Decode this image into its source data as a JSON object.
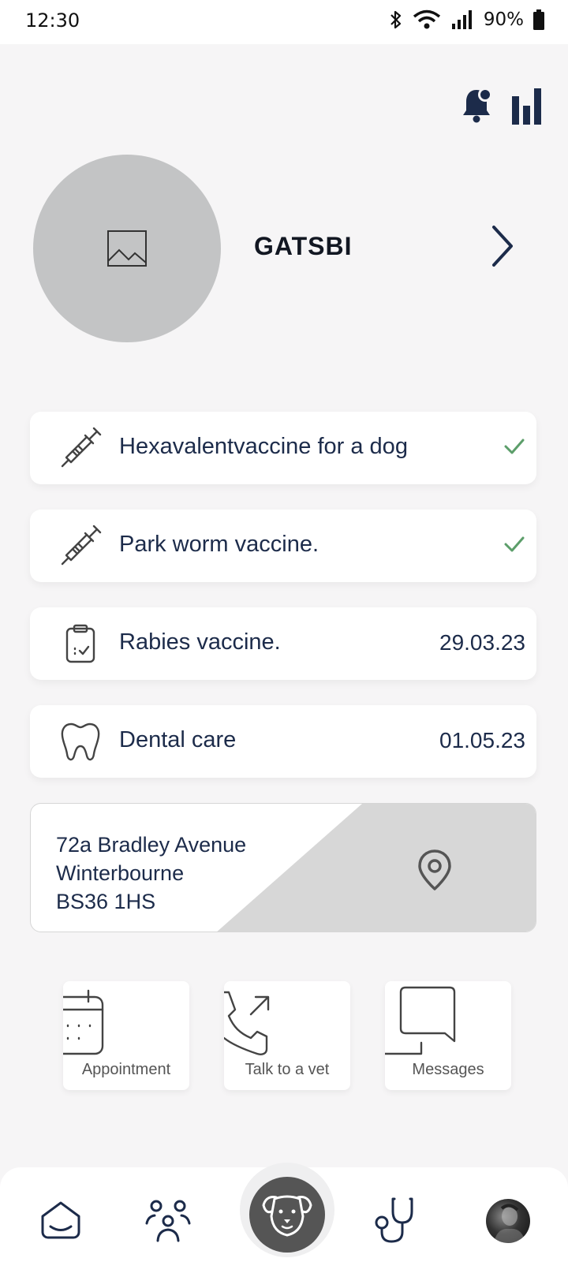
{
  "status_bar": {
    "time": "12:30",
    "battery": "90%",
    "icons": [
      "bluetooth-icon",
      "wifi-icon",
      "signal-icon",
      "battery-icon"
    ]
  },
  "header": {
    "icons": [
      "notification-bell-icon",
      "stats-bars-icon"
    ]
  },
  "profile": {
    "name": "GATSBI",
    "photo_icon": "image-placeholder-icon",
    "chevron_icon": "chevron-right-icon"
  },
  "health_items": [
    {
      "icon": "syringe-icon",
      "label": "Hexavalentvaccine for a dog",
      "status": "done",
      "date": ""
    },
    {
      "icon": "syringe-icon",
      "label": "Park worm vaccine.",
      "status": "done",
      "date": ""
    },
    {
      "icon": "clipboard-check-icon",
      "label": "Rabies vaccine.",
      "status": "scheduled",
      "date": "29.03.23"
    },
    {
      "icon": "tooth-icon",
      "label": "Dental care",
      "status": "scheduled",
      "date": "01.05.23"
    }
  ],
  "address": {
    "line1": "72a Bradley Avenue",
    "line2": "Winterbourne",
    "line3": "BS36 1HS",
    "icon": "map-pin-icon"
  },
  "actions": [
    {
      "icon": "calendar-icon",
      "label": "Appointment"
    },
    {
      "icon": "phone-outgoing-icon",
      "label": "Talk to a vet"
    },
    {
      "icon": "chat-bubble-icon",
      "label": "Messages"
    }
  ],
  "bottom_nav": {
    "items": [
      "home-icon",
      "people-icon",
      "dog-face-icon",
      "stethoscope-icon",
      "user-avatar"
    ],
    "active": "dog-face-icon"
  },
  "colors": {
    "navy": "#1c2b4a",
    "check_green": "#5c9e6a",
    "avatar_gray": "#c3c4c5",
    "center_button": "#555555"
  }
}
